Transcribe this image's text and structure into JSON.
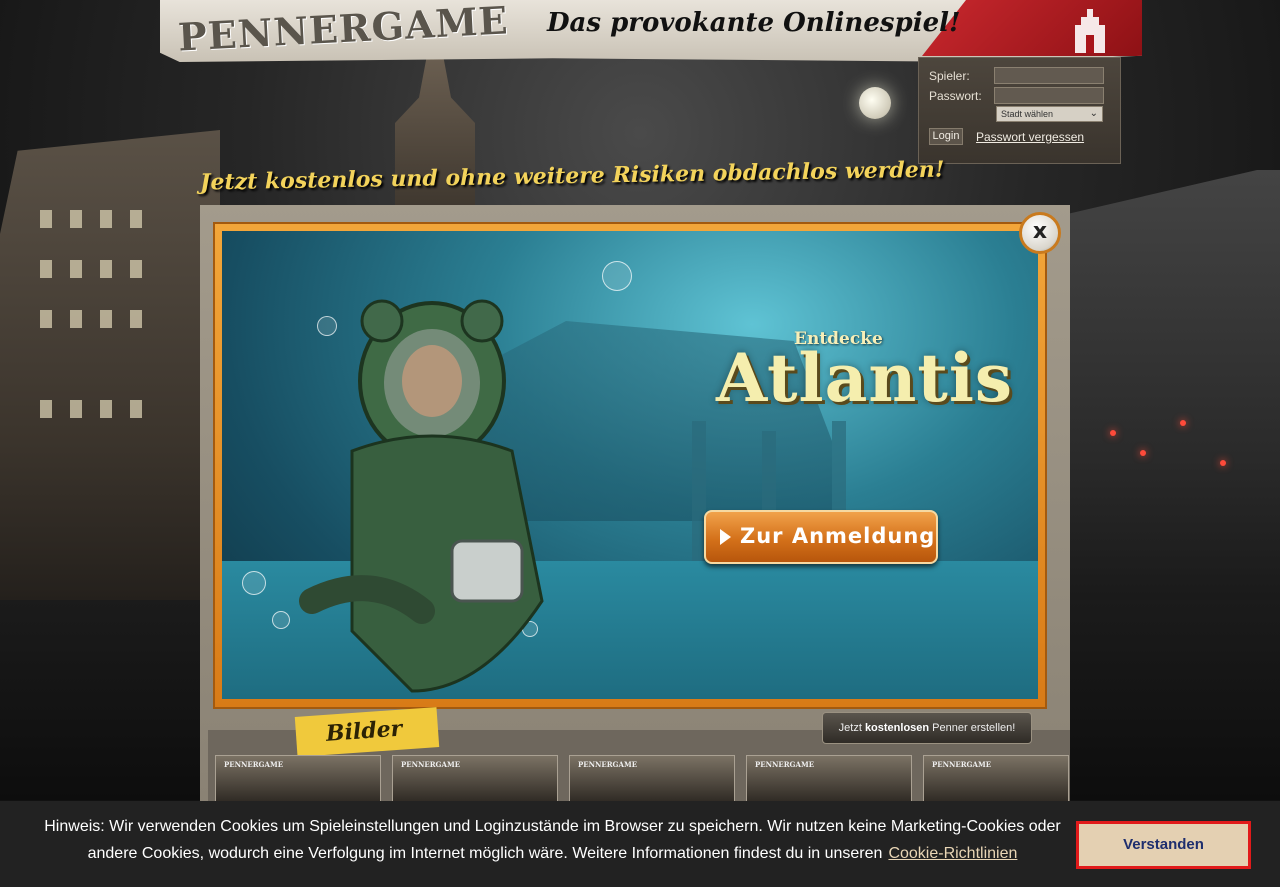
{
  "header": {
    "logo_text": "PENNERGAME",
    "slogan": "Das provokante Onlinespiel!"
  },
  "login": {
    "player_label": "Spieler:",
    "password_label": "Passwort:",
    "city_select": "Stadt wählen",
    "login_button": "Login",
    "forgot_link": "Passwort vergessen"
  },
  "tagline": "Jetzt kostenlos und ohne weitere Risiken obdachlos werden!",
  "promo": {
    "kicker": "Entdecke",
    "title": "Atlantis",
    "cta": "Zur Anmeldung",
    "close": "x"
  },
  "gallery": {
    "label": "Bilder",
    "register_prefix": "Jetzt ",
    "register_bold": "kostenlosen",
    "register_suffix": " Penner erstellen!",
    "thumb_logo": "PENNERGAME"
  },
  "cookie": {
    "message": "Hinweis: Wir verwenden Cookies um Spieleinstellungen und Loginzustände im Browser zu speichern. Wir nutzen keine Marketing-Cookies oder andere Cookies, wodurch eine Verfolgung im Internet möglich wäre. Weitere Informationen findest du in unseren",
    "link": "Cookie-Richtlinien",
    "accept": "Verstanden"
  },
  "colors": {
    "accent_orange": "#d87b17",
    "tagline_yellow": "#f3d35b",
    "cookie_border": "#e11a1a"
  }
}
